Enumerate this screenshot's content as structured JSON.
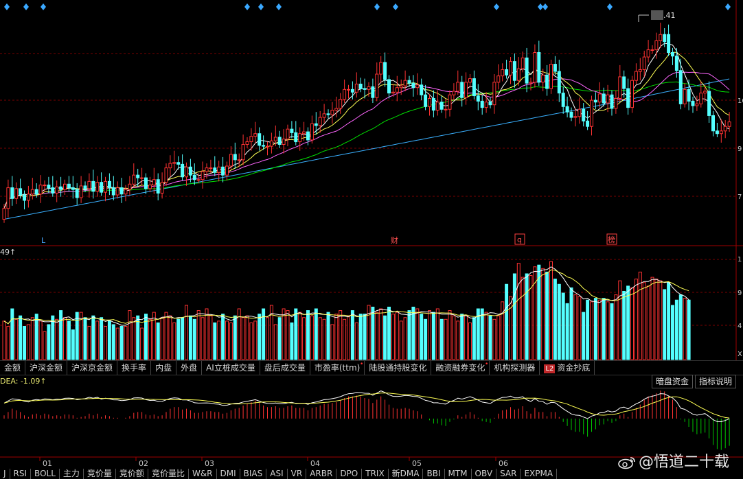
{
  "chart_data": {
    "type": "candlestick",
    "price_labels": [
      "10",
      "9",
      "7"
    ],
    "price_top_label": ".41",
    "event_labels": {
      "l": "L",
      "cai": "财",
      "q": "q",
      "bang": "榜"
    },
    "volume_label": "49↑",
    "volume_scale_labels": [
      "1",
      "9",
      "4",
      "X"
    ],
    "macd_label": "DEA: -1.09↑",
    "x_ticks": [
      "01",
      "02",
      "03",
      "04",
      "05",
      "06"
    ],
    "candles": [
      [
        6.97,
        7.09
      ],
      [
        7.09,
        7.32
      ],
      [
        7.32,
        7.2
      ],
      [
        7.2,
        7.31
      ],
      [
        7.31,
        7.24
      ],
      [
        7.24,
        7.18
      ],
      [
        7.18,
        7.25
      ],
      [
        7.25,
        7.3
      ],
      [
        7.3,
        7.25
      ],
      [
        7.25,
        7.35
      ],
      [
        7.35,
        7.35
      ],
      [
        7.35,
        7.32
      ],
      [
        7.32,
        7.26
      ],
      [
        7.26,
        7.33
      ],
      [
        7.33,
        7.3
      ],
      [
        7.3,
        7.36
      ],
      [
        7.36,
        7.32
      ],
      [
        7.32,
        7.3
      ],
      [
        7.3,
        7.21
      ],
      [
        7.21,
        7.34
      ],
      [
        7.34,
        7.31
      ],
      [
        7.31,
        7.39
      ],
      [
        7.39,
        7.28
      ],
      [
        7.28,
        7.38
      ],
      [
        7.38,
        7.27
      ],
      [
        7.27,
        7.39
      ],
      [
        7.39,
        7.32
      ],
      [
        7.32,
        7.24
      ],
      [
        7.24,
        7.32
      ],
      [
        7.32,
        7.25
      ],
      [
        7.25,
        7.3
      ],
      [
        7.3,
        7.36
      ],
      [
        7.36,
        7.46
      ],
      [
        7.46,
        7.43
      ],
      [
        7.43,
        7.43
      ],
      [
        7.43,
        7.31
      ],
      [
        7.31,
        7.35
      ],
      [
        7.35,
        7.41
      ],
      [
        7.41,
        7.26
      ],
      [
        7.26,
        7.38
      ],
      [
        7.38,
        7.54
      ],
      [
        7.54,
        7.59
      ],
      [
        7.59,
        7.6
      ],
      [
        7.6,
        7.58
      ],
      [
        7.58,
        7.44
      ],
      [
        7.44,
        7.55
      ],
      [
        7.55,
        7.46
      ],
      [
        7.46,
        7.41
      ],
      [
        7.41,
        7.41
      ],
      [
        7.41,
        7.5
      ],
      [
        7.5,
        7.54
      ],
      [
        7.54,
        7.54
      ],
      [
        7.54,
        7.49
      ],
      [
        7.49,
        7.55
      ],
      [
        7.55,
        7.46
      ],
      [
        7.46,
        7.56
      ],
      [
        7.56,
        7.69
      ],
      [
        7.69,
        7.63
      ],
      [
        7.63,
        7.63
      ],
      [
        7.63,
        7.8
      ],
      [
        7.8,
        7.83
      ],
      [
        7.83,
        7.89
      ],
      [
        7.89,
        7.92
      ],
      [
        7.92,
        7.79
      ],
      [
        7.79,
        7.78
      ],
      [
        7.78,
        7.78
      ],
      [
        7.78,
        7.84
      ],
      [
        7.84,
        7.88
      ],
      [
        7.88,
        7.8
      ],
      [
        7.8,
        7.86
      ],
      [
        7.86,
        7.97
      ],
      [
        7.97,
        7.93
      ],
      [
        7.93,
        7.83
      ],
      [
        7.83,
        7.92
      ],
      [
        7.92,
        7.94
      ],
      [
        7.94,
        7.85
      ],
      [
        7.85,
        8.03
      ],
      [
        8.03,
        8.01
      ],
      [
        8.01,
        8.1
      ],
      [
        8.1,
        8.14
      ],
      [
        8.14,
        8.13
      ],
      [
        8.13,
        8.18
      ],
      [
        8.18,
        8.2
      ],
      [
        8.2,
        8.3
      ],
      [
        8.3,
        8.41
      ],
      [
        8.41,
        8.41
      ],
      [
        8.41,
        8.38
      ],
      [
        8.38,
        8.47
      ],
      [
        8.47,
        8.42
      ],
      [
        8.42,
        8.41
      ],
      [
        8.41,
        8.44
      ],
      [
        8.44,
        8.32
      ],
      [
        8.32,
        8.58
      ],
      [
        8.58,
        8.71
      ],
      [
        8.71,
        8.52
      ],
      [
        8.52,
        8.37
      ],
      [
        8.37,
        8.38
      ],
      [
        8.38,
        8.43
      ],
      [
        8.43,
        8.45
      ],
      [
        8.45,
        8.51
      ],
      [
        8.51,
        8.48
      ],
      [
        8.48,
        8.43
      ],
      [
        8.43,
        8.46
      ],
      [
        8.46,
        8.35
      ],
      [
        8.35,
        8.22
      ],
      [
        8.22,
        8.31
      ],
      [
        8.31,
        8.18
      ],
      [
        8.18,
        8.27
      ],
      [
        8.27,
        8.19
      ],
      [
        8.19,
        8.19
      ],
      [
        8.19,
        8.35
      ],
      [
        8.35,
        8.39
      ],
      [
        8.39,
        8.49
      ],
      [
        8.49,
        8.32
      ],
      [
        8.32,
        8.49
      ],
      [
        8.49,
        8.53
      ],
      [
        8.53,
        8.34
      ],
      [
        8.34,
        8.28
      ],
      [
        8.28,
        8.21
      ],
      [
        8.21,
        8.27
      ],
      [
        8.27,
        8.24
      ],
      [
        8.24,
        8.49
      ],
      [
        8.49,
        8.56
      ],
      [
        8.56,
        8.63
      ],
      [
        8.63,
        8.57
      ],
      [
        8.57,
        8.72
      ],
      [
        8.72,
        8.51
      ],
      [
        8.51,
        8.64
      ],
      [
        8.64,
        8.76
      ],
      [
        8.76,
        8.48
      ],
      [
        8.48,
        8.49
      ],
      [
        8.49,
        8.82
      ],
      [
        8.82,
        8.49
      ],
      [
        8.49,
        8.57
      ],
      [
        8.57,
        8.42
      ],
      [
        8.42,
        8.69
      ],
      [
        8.69,
        8.61
      ],
      [
        8.61,
        8.37
      ],
      [
        8.37,
        8.22
      ],
      [
        8.22,
        8.16
      ],
      [
        8.16,
        8.1
      ],
      [
        8.1,
        8.11
      ],
      [
        8.11,
        8.19
      ],
      [
        8.19,
        8.06
      ],
      [
        8.06,
        8.0
      ],
      [
        8.0,
        8.29
      ],
      [
        8.29,
        8.27
      ],
      [
        8.27,
        8.36
      ],
      [
        8.36,
        8.26
      ],
      [
        8.26,
        8.35
      ],
      [
        8.35,
        8.2
      ],
      [
        8.2,
        8.31
      ],
      [
        8.31,
        8.55
      ],
      [
        8.55,
        8.42
      ],
      [
        8.42,
        8.21
      ],
      [
        8.21,
        8.51
      ],
      [
        8.51,
        8.61
      ],
      [
        8.61,
        8.63
      ],
      [
        8.63,
        8.77
      ],
      [
        8.77,
        8.85
      ],
      [
        8.85,
        8.85
      ],
      [
        8.85,
        8.95
      ],
      [
        8.95,
        9.02
      ],
      [
        9.02,
        8.94
      ],
      [
        9.02,
        8.82
      ],
      [
        8.82,
        8.78
      ],
      [
        8.78,
        8.62
      ],
      [
        8.62,
        8.25
      ],
      [
        8.25,
        8.41
      ],
      [
        8.41,
        8.28
      ],
      [
        8.28,
        8.23
      ],
      [
        8.23,
        8.25
      ],
      [
        8.25,
        8.37
      ],
      [
        8.37,
        8.39
      ],
      [
        8.39,
        8.12
      ],
      [
        8.12,
        7.95
      ],
      [
        7.95,
        7.92
      ],
      [
        7.92,
        7.95
      ],
      [
        7.95,
        8.0
      ],
      [
        8.0,
        8.05
      ]
    ],
    "volume": [
      22,
      19,
      29,
      23,
      25,
      19,
      20,
      24,
      26,
      22,
      16,
      20,
      25,
      23,
      28,
      24,
      22,
      17,
      27,
      27,
      24,
      19,
      25,
      22,
      24,
      19,
      22,
      20,
      18,
      19,
      19,
      28,
      24,
      25,
      18,
      26,
      23,
      27,
      21,
      24,
      27,
      25,
      21,
      23,
      24,
      31,
      25,
      23,
      28,
      24,
      29,
      25,
      21,
      22,
      26,
      22,
      21,
      25,
      29,
      24,
      25,
      21,
      22,
      26,
      29,
      24,
      31,
      20,
      24,
      29,
      28,
      21,
      29,
      27,
      24,
      28,
      25,
      29,
      24,
      23,
      27,
      20,
      26,
      28,
      23,
      25,
      28,
      21,
      26,
      26,
      31,
      30,
      27,
      29,
      25,
      30,
      26,
      27,
      22,
      24,
      28,
      30,
      29,
      26,
      23,
      28,
      27,
      29,
      23,
      23,
      28,
      25,
      22,
      26,
      25,
      21,
      24,
      29,
      29,
      27,
      25,
      23,
      25,
      33,
      43,
      36,
      49,
      55,
      47,
      49,
      48,
      53,
      54,
      52,
      50,
      56,
      46,
      43,
      38,
      32,
      41,
      37,
      36,
      27,
      34,
      33,
      35,
      34,
      35,
      33,
      32,
      37,
      45,
      39,
      42,
      41,
      46,
      50,
      44,
      42,
      47,
      46,
      45,
      40,
      44,
      31,
      34,
      37,
      35,
      34
    ],
    "macd": [
      0.04,
      0.08,
      0.12,
      0.1,
      0.08,
      0.04,
      0.02,
      0.05,
      0.06,
      0.04,
      0.06,
      0.05,
      0.03,
      0.04,
      0.03,
      0.05,
      0.05,
      0.04,
      0.01,
      0.02,
      0.03,
      0.06,
      0.04,
      0.06,
      0.02,
      0.04,
      0.03,
      0.01,
      0.01,
      0.0,
      0.01,
      0.03,
      0.07,
      0.08,
      0.08,
      0.05,
      0.04,
      0.05,
      0.03,
      0.04,
      0.08,
      0.12,
      0.14,
      0.14,
      0.11,
      0.12,
      0.1,
      0.07,
      0.07,
      0.08,
      0.09,
      0.09,
      0.08,
      0.08,
      0.06,
      0.07,
      0.1,
      0.12,
      0.13,
      0.16,
      0.18,
      0.2,
      0.22,
      0.19,
      0.16,
      0.14,
      0.14,
      0.15,
      0.13,
      0.13,
      0.15,
      0.16,
      0.13,
      0.13,
      0.13,
      0.1,
      0.13,
      0.14,
      0.16,
      0.18,
      0.18,
      0.19,
      0.2,
      0.22,
      0.25,
      0.27,
      0.27,
      0.28,
      0.27,
      0.25,
      0.24,
      0.19,
      0.23,
      0.27,
      0.23,
      0.17,
      0.13,
      0.12,
      0.12,
      0.13,
      0.12,
      0.1,
      0.09,
      0.05,
      0.0,
      -0.02,
      -0.06,
      -0.06,
      -0.08,
      -0.09,
      -0.04,
      -0.01,
      0.04,
      0.02,
      0.05,
      0.08,
      0.05,
      0.01,
      -0.03,
      -0.04,
      -0.05,
      0.01,
      0.06,
      0.1,
      0.11,
      0.14,
      0.11,
      0.12,
      0.15,
      0.09,
      0.06,
      0.13,
      0.08,
      0.08,
      0.03,
      0.08,
      0.08,
      0.02,
      -0.04,
      -0.09,
      -0.14,
      -0.16,
      -0.16,
      -0.19,
      -0.22,
      -0.16,
      -0.13,
      -0.08,
      -0.07,
      -0.03,
      -0.05,
      -0.03,
      0.04,
      0.06,
      0.02,
      0.08,
      0.13,
      0.17,
      0.23,
      0.27,
      0.29,
      0.31,
      0.34,
      0.33,
      0.28,
      0.23,
      0.14,
      -0.01,
      -0.04,
      -0.1,
      -0.16,
      -0.19,
      -0.18,
      -0.17,
      -0.24,
      -0.32,
      -0.37,
      -0.38,
      -0.36,
      -0.33
    ]
  },
  "tabs_row1": [
    {
      "label": "金额"
    },
    {
      "label": "沪深金额"
    },
    {
      "label": "沪深京金额"
    },
    {
      "label": "换手率"
    },
    {
      "label": "内盘"
    },
    {
      "label": "外盘"
    },
    {
      "label": "AI立桩成交量"
    },
    {
      "label": "盘后成交量"
    },
    {
      "label": "市盈率(ttm)",
      "dot": true
    },
    {
      "label": "陆股通持股变化"
    },
    {
      "label": "融资融券变化",
      "dot": true
    },
    {
      "label": "机构探测器"
    },
    {
      "label": "资金抄底",
      "badge": "L2"
    }
  ],
  "right_buttons": {
    "hidden_funds": "暗盘资金",
    "indicator_help": "指标说明"
  },
  "tabs_row2": [
    "J",
    "RSI",
    "BOLL",
    "主力",
    "竞价量",
    "竞价额",
    "竞价量比",
    "W&R",
    "DMI",
    "BIAS",
    "ASI",
    "VR",
    "ARBR",
    "DPO",
    "TRIX",
    "新DMA",
    "BBI",
    "MTM",
    "OBV",
    "SAR",
    "EXPMA"
  ],
  "watermark": "@悟道二十载",
  "colors": {
    "up": "#ff3232",
    "down": "#54ffff",
    "ma5": "#ffffff",
    "ma10": "#ffff54",
    "ma20": "#ff66ff",
    "ma60": "#00e000",
    "ma250": "#3ab0ff",
    "grid": "#7a0000",
    "axis": "#a00000",
    "macd_neg": "#00c800"
  }
}
